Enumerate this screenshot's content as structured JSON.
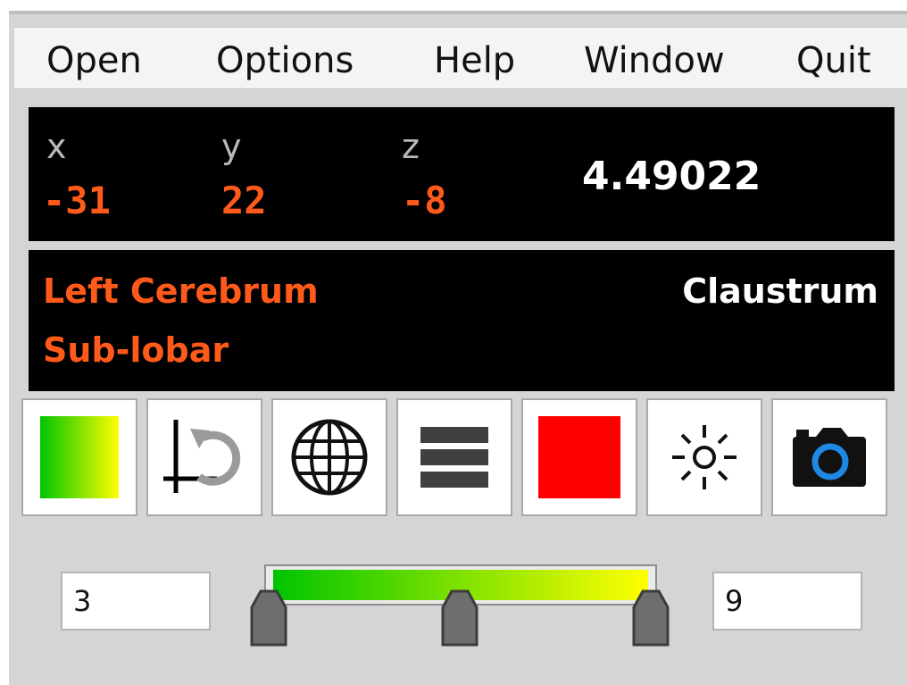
{
  "menu": {
    "open": "Open",
    "options": "Options",
    "help": "Help",
    "window": "Window",
    "quit": "Quit"
  },
  "coordinates": {
    "x_label": "x",
    "y_label": "y",
    "z_label": "z",
    "x_value": "-31",
    "y_value": "22",
    "z_value": "-8",
    "intensity": "4.49022"
  },
  "region": {
    "hemisphere": "Left Cerebrum",
    "lobe": "Sub-lobar",
    "structure": "Claustrum"
  },
  "toolbar": {
    "buttons": [
      {
        "icon": "colormap-gradient-icon"
      },
      {
        "icon": "reset-axes-icon"
      },
      {
        "icon": "globe-icon"
      },
      {
        "icon": "layers-icon"
      },
      {
        "icon": "red-color-swatch-icon"
      },
      {
        "icon": "brightness-icon"
      },
      {
        "icon": "camera-icon"
      }
    ]
  },
  "threshold": {
    "min": "3",
    "max": "9",
    "mid_fraction": 0.5
  },
  "colors": {
    "accent_orange": "#ff5a1a",
    "gradient_start": "#00c400",
    "gradient_end": "#ffff00",
    "swatch_red": "#ff0000",
    "camera_blue": "#1e88e5"
  }
}
